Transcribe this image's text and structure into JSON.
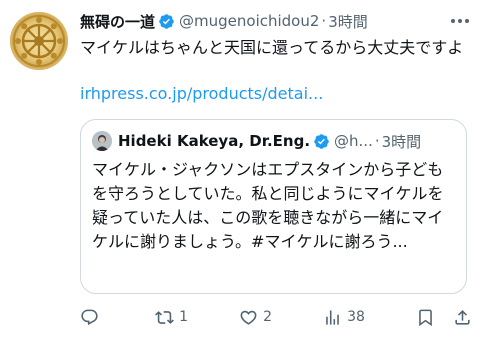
{
  "tweet": {
    "display_name": "無碍の一道",
    "handle": "@mugenoichidou2",
    "separator": "·",
    "time": "3時間",
    "body": "マイケルはちゃんと天国に還ってるから大丈夫ですよ",
    "link": "irhpress.co.jp/products/detai...",
    "avatar_icon": "dharma-wheel-icon",
    "verified_icon": "verified-badge-icon"
  },
  "quote": {
    "display_name": "Hideki Kakeya, Dr.Eng.",
    "handle": "@h...",
    "separator": "·",
    "time": "3時間",
    "body": "マイケル・ジャクソンはエプスタインから子どもを守ろうとしていた。私と同じようにマイケルを疑っていた人は、この歌を聴きながら一緒にマイケルに謝りましょう。#マイケルに謝ろう..."
  },
  "actions": {
    "reply": {
      "icon": "reply-icon",
      "count": ""
    },
    "retweet": {
      "icon": "retweet-icon",
      "count": "1"
    },
    "like": {
      "icon": "heart-icon",
      "count": "2"
    },
    "views": {
      "icon": "views-icon",
      "count": "38"
    },
    "bookmark": {
      "icon": "bookmark-icon"
    },
    "share": {
      "icon": "share-icon"
    }
  },
  "colors": {
    "accent": "#1d9bf0",
    "text": "#0f1419",
    "muted": "#536471",
    "border": "#cfd9de"
  }
}
